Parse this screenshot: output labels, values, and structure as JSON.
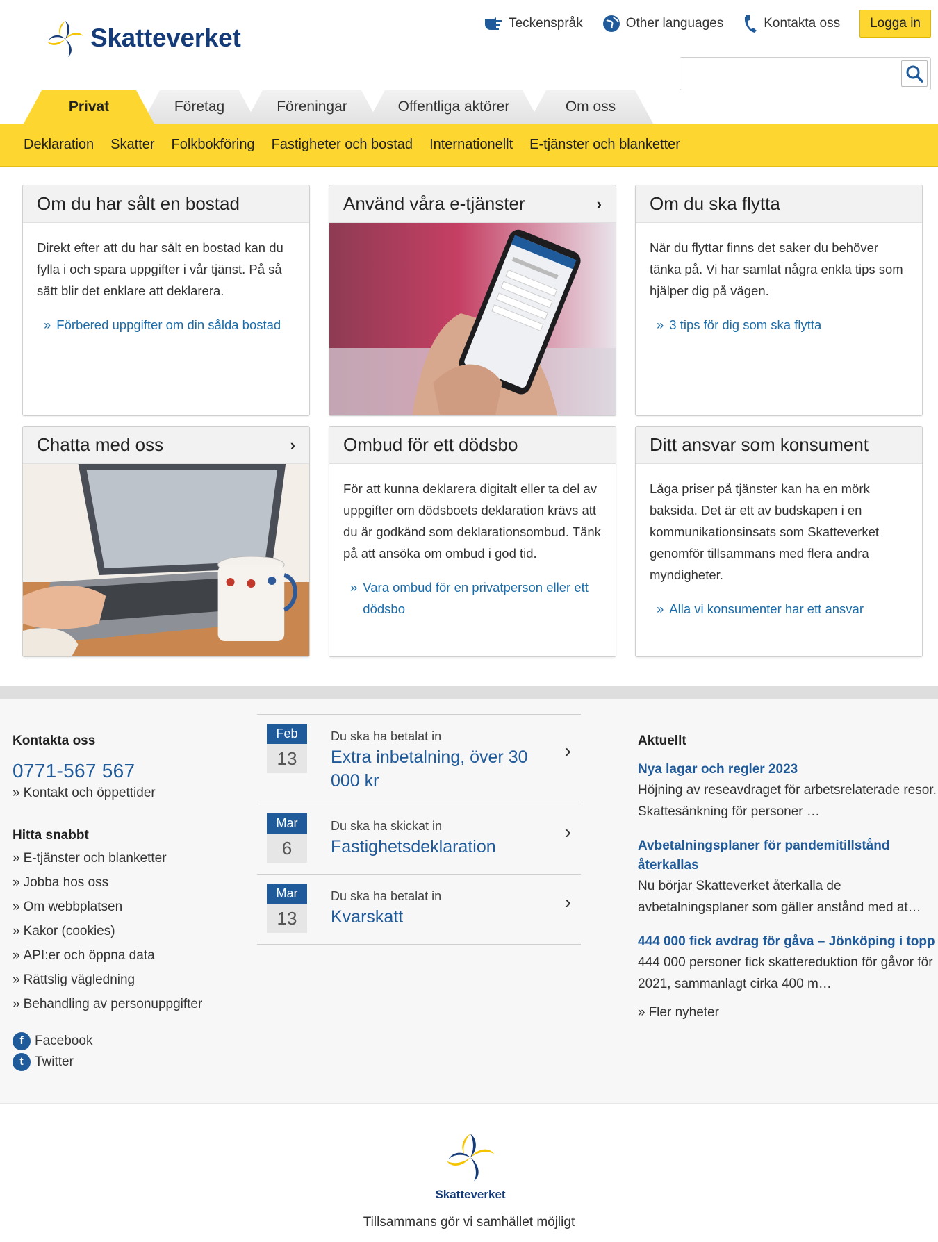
{
  "header": {
    "logo_text": "Skatteverket",
    "links": [
      "Teckenspråk",
      "Other languages",
      "Kontakta oss"
    ],
    "login_label": "Logga in",
    "search_placeholder": ""
  },
  "tabs": [
    "Privat",
    "Företag",
    "Föreningar",
    "Offentliga aktörer",
    "Om oss"
  ],
  "subnav": [
    "Deklaration",
    "Skatter",
    "Folkbokföring",
    "Fastigheter och bostad",
    "Internationellt",
    "E-tjänster och blanketter"
  ],
  "cards": [
    {
      "title": "Om du har sålt en bostad",
      "text": "Direkt efter att du har sålt en bostad kan du fylla i och spara uppgifter i vår tjänst. På så sätt blir det enklare att deklarera.",
      "link": "Förbered uppgifter om din sålda bostad"
    },
    {
      "title": "Använd våra e-tjänster"
    },
    {
      "title": "Om du ska flytta",
      "text": "När du flyttar finns det saker du behöver tänka på. Vi har samlat några enkla tips som hjälper dig på vägen.",
      "link": "3 tips för dig som ska flytta"
    },
    {
      "title": "Chatta med oss"
    },
    {
      "title": "Ombud för ett dödsbo",
      "text": "För att kunna deklarera digitalt eller ta del av uppgifter om dödsboets deklaration krävs att du är godkänd som deklarationsombud. Tänk på att ansöka om ombud i god tid.",
      "link": "Vara ombud för en privatperson eller ett dödsbo"
    },
    {
      "title": "Ditt ansvar som konsument",
      "text": "Låga priser på tjänster kan ha en mörk baksida. Det är ett av budskapen i en kommunikationsinsats som Skatteverket genomför tillsammans med flera andra myndigheter.",
      "link": "Alla vi konsumenter har ett ansvar"
    }
  ],
  "footer": {
    "contact_heading": "Kontakta oss",
    "phone": "0771-567 567",
    "contact_link": "Kontakt och öppettider",
    "quick_heading": "Hitta snabbt",
    "quick_links": [
      "E-tjänster och blanketter",
      "Jobba hos oss",
      "Om webbplatsen",
      "Kakor (cookies)",
      "API:er och öppna data",
      "Rättslig vägledning",
      "Behandling av personuppgifter"
    ],
    "social": [
      "Facebook",
      "Twitter"
    ],
    "dates": [
      {
        "month": "Feb",
        "day": "13",
        "pre": "Du ska ha betalat in",
        "title": "Extra inbetalning, över 30 000 kr"
      },
      {
        "month": "Mar",
        "day": "6",
        "pre": "Du ska ha skickat in",
        "title": "Fastighetsdeklaration"
      },
      {
        "month": "Mar",
        "day": "13",
        "pre": "Du ska ha betalat in",
        "title": "Kvarskatt"
      }
    ],
    "news_heading": "Aktuellt",
    "news": [
      {
        "title": "Nya lagar och regler 2023",
        "text": "Höjning av reseavdraget för arbetsrelaterade resor. Skattesänkning för personer …"
      },
      {
        "title": "Avbetalningsplaner för pandemitillstånd återkallas",
        "text": "Nu börjar Skatteverket återkalla de avbetalningsplaner som gäller anstånd med at…"
      },
      {
        "title": "444 000 fick avdrag för gåva – Jönköping i topp",
        "text": "444 000 personer fick skattereduktion för gåvor för 2021, sammanlagt cirka 400 m…"
      }
    ],
    "more_news": "Fler nyheter",
    "bottom_logo_text": "Skatteverket",
    "tagline": "Tillsammans gör vi samhället möjligt"
  },
  "colors": {
    "accent_yellow": "#fdd72f",
    "brand_blue": "#153c79",
    "link_blue": "#1b6ca8"
  }
}
